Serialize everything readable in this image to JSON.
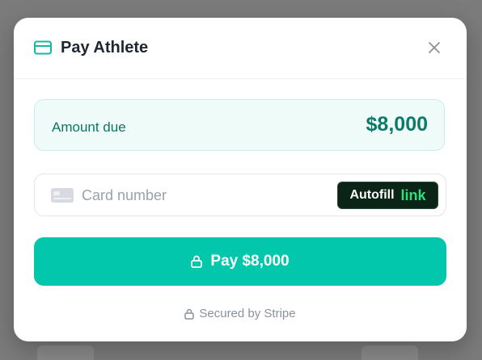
{
  "modal": {
    "title": "Pay Athlete"
  },
  "amount": {
    "label": "Amount due",
    "value": "$8,000"
  },
  "card": {
    "placeholder": "Card number",
    "autofill_label": "Autofill",
    "link_label": "link"
  },
  "pay_button": {
    "label": "Pay $8,000"
  },
  "footer": {
    "secured_text": "Secured by Stripe"
  },
  "colors": {
    "accent": "#03c7ad",
    "amount_text": "#0d7b68",
    "link_green": "#2ee07a"
  },
  "icons": [
    "credit-card-icon",
    "close-icon",
    "card-brand-icon",
    "lock-icon"
  ]
}
